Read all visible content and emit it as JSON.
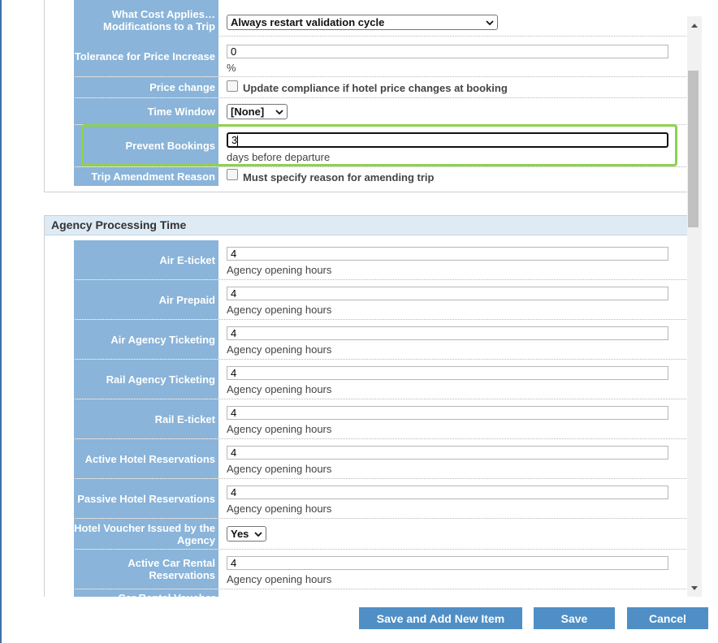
{
  "top_rows": [
    {
      "label": "What Cost Applies… Modifications to a Trip",
      "type": "select",
      "value": "Always restart validation cycle"
    },
    {
      "label": "Tolerance for Price Increase",
      "type": "text",
      "value": "0",
      "sub": "%"
    },
    {
      "label": "Price change",
      "type": "checkbox",
      "checked": false,
      "text": "Update compliance if hotel price changes at booking"
    },
    {
      "label": "Time Window",
      "type": "select",
      "value": "[None]"
    },
    {
      "label": "Prevent Bookings",
      "type": "text",
      "value": "3",
      "sub": "days before departure",
      "focused": true
    },
    {
      "label": "Trip Amendment Reason",
      "type": "checkbox",
      "checked": false,
      "text": "Must specify reason for amending trip"
    }
  ],
  "agency_section": {
    "title": "Agency Processing Time",
    "rows": [
      {
        "label": "Air E-ticket",
        "type": "text",
        "value": "4",
        "sub": "Agency opening hours"
      },
      {
        "label": "Air Prepaid",
        "type": "text",
        "value": "4",
        "sub": "Agency opening hours"
      },
      {
        "label": "Air Agency Ticketing",
        "type": "text",
        "value": "4",
        "sub": "Agency opening hours"
      },
      {
        "label": "Rail Agency Ticketing",
        "type": "text",
        "value": "4",
        "sub": "Agency opening hours"
      },
      {
        "label": "Rail E-ticket",
        "type": "text",
        "value": "4",
        "sub": "Agency opening hours"
      },
      {
        "label": "Active Hotel Reservations",
        "type": "text",
        "value": "4",
        "sub": "Agency opening hours"
      },
      {
        "label": "Passive Hotel Reservations",
        "type": "text",
        "value": "4",
        "sub": "Agency opening hours"
      },
      {
        "label": "Hotel Voucher Issued by the Agency",
        "type": "select",
        "value": "Yes"
      },
      {
        "label": "Active Car Rental Reservations",
        "type": "text",
        "value": "4",
        "sub": "Agency opening hours"
      },
      {
        "label": "Car Rental Voucher Issued…",
        "type": "partial"
      }
    ]
  },
  "buttons": {
    "save_add": "Save and Add New Item",
    "save": "Save",
    "cancel": "Cancel"
  },
  "colors": {
    "label_bg": "#8ab4d9",
    "button_bg": "#4f8fc6",
    "highlight": "#8fd14f",
    "section_header_bg": "#deeaf4"
  }
}
